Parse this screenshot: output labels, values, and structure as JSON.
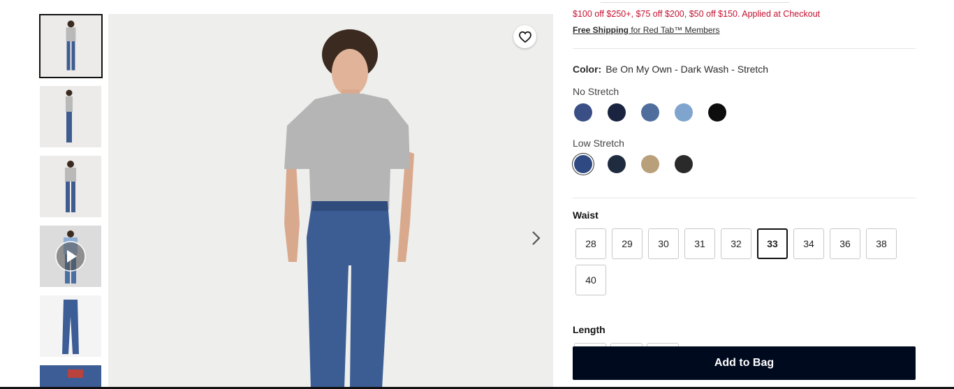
{
  "promo": {
    "offer_text": "$100 off $250+, $75 off $200, $50 off $150. Applied at Checkout",
    "shipping_link": "Free Shipping",
    "shipping_rest": " for Red Tab™ Members"
  },
  "color": {
    "label": "Color:",
    "value": "Be On My Own - Dark Wash - Stretch",
    "groups": [
      {
        "name": "No Stretch",
        "swatches": [
          "#3a4f86",
          "#1a2340",
          "#4f6e9e",
          "#7fa5cf",
          "#0d0d0d"
        ]
      },
      {
        "name": "Low Stretch",
        "swatches": [
          "#2f4a82",
          "#1f2b3e",
          "#b9a07a",
          "#2a2a2a"
        ]
      }
    ],
    "selected": "Low Stretch #1"
  },
  "waist": {
    "label": "Waist",
    "sizes": [
      "28",
      "29",
      "30",
      "31",
      "32",
      "33",
      "34",
      "36",
      "38",
      "40"
    ],
    "selected": "33"
  },
  "length": {
    "label": "Length"
  },
  "cta": {
    "add_to_bag": "Add to Bag"
  },
  "icons": {
    "favorite": "heart-icon",
    "next": "chevron-right-icon",
    "play": "play-icon"
  }
}
